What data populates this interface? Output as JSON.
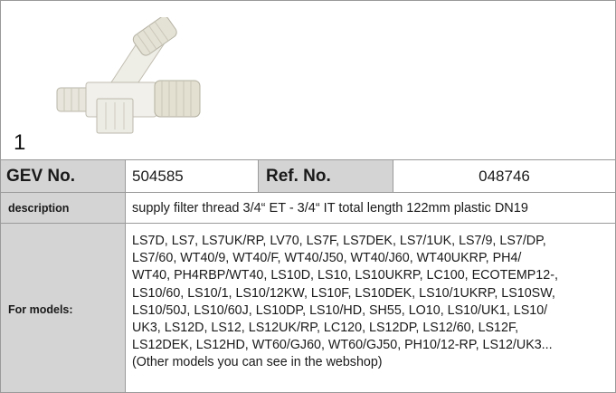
{
  "product": {
    "image_alt": "white plastic Y-shaped supply filter with threaded connectors",
    "index_label": "1"
  },
  "specs": {
    "gev_label": "GEV No.",
    "gev_value": "504585",
    "ref_label": "Ref. No.",
    "ref_value": "048746",
    "description_label": "description",
    "description_value": "supply filter  thread 3/4“ ET - 3/4“ IT total length 122mm plastic DN19",
    "models_label": "For models:",
    "models_lines": [
      "LS7D, LS7, LS7UK/RP, LV70, LS7F, LS7DEK, LS7/1UK, LS7/9, LS7/DP,",
      "LS7/60, WT40/9, WT40/F, WT40/J50, WT40/J60, WT40UKRP, PH4/",
      "WT40, PH4RBP/WT40, LS10D, LS10, LS10UKRP, LC100, ECOTEMP12-,",
      "LS10/60, LS10/1, LS10/12KW, LS10F, LS10DEK, LS10/1UKRP, LS10SW,",
      "LS10/50J, LS10/60J, LS10DP, LS10/HD, SH55, LO10, LS10/UK1, LS10/",
      "UK3, LS12D, LS12, LS12UK/RP, LC120, LS12DP, LS12/60, LS12F,",
      "LS12DEK, LS12HD, WT60/GJ60, WT60/GJ50, PH10/12-RP, LS12/UK3...",
      "(Other models you can see in the webshop)"
    ]
  }
}
